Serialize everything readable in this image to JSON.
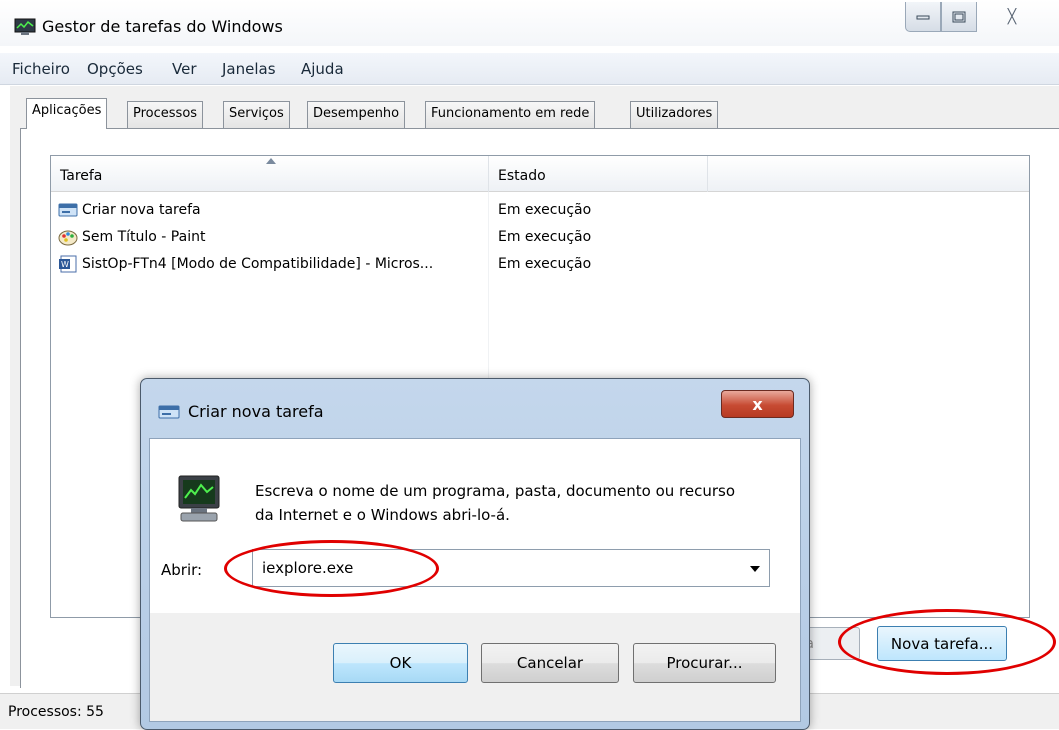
{
  "window": {
    "title": "Gestor de tarefas do Windows",
    "close_glyph": "╳"
  },
  "menu": [
    "Ficheiro",
    "Opções",
    "Ver",
    "Janelas",
    "Ajuda"
  ],
  "tabs": [
    "Aplicações",
    "Processos",
    "Serviços",
    "Desempenho",
    "Funcionamento em rede",
    "Utilizadores"
  ],
  "task_list": {
    "columns": [
      "Tarefa",
      "Estado"
    ],
    "rows": [
      {
        "name": "Criar nova tarefa",
        "state": "Em execução",
        "icon": "run-dialog-icon"
      },
      {
        "name": "Sem Título - Paint",
        "state": "Em execução",
        "icon": "paint-icon"
      },
      {
        "name": "SistOp-FTn4 [Modo de Compatibilidade] - Micros...",
        "state": "Em execução",
        "icon": "word-icon"
      }
    ]
  },
  "buttons": {
    "end_task_partial": "ara",
    "new_task": "Nova tarefa..."
  },
  "status": {
    "processes": "Processos: 55"
  },
  "dialog": {
    "title": "Criar nova tarefa",
    "close_glyph": "x",
    "message": "Escreva o nome de um programa, pasta, documento ou recurso da Internet e o Windows abri-lo-á.",
    "open_label": "Abrir:",
    "open_value": "iexplore.exe",
    "ok": "OK",
    "cancel": "Cancelar",
    "browse": "Procurar..."
  },
  "colors": {
    "highlight_ellipse": "#e00000",
    "dialog_frame": "#b8cde5",
    "close_button": "#c74b33"
  }
}
